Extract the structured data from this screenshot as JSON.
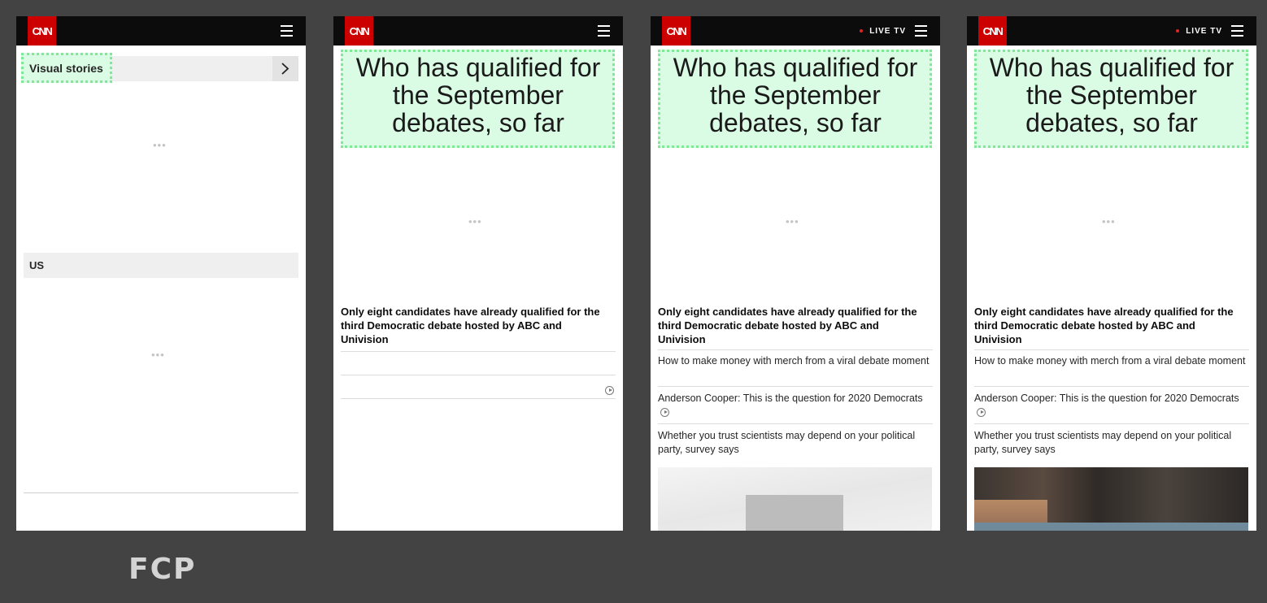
{
  "logo_text": "CNN",
  "live_tv": "LIVE TV",
  "frame1": {
    "section_visual_stories": "Visual stories",
    "section_us": "US",
    "loading_dots": "•••"
  },
  "article": {
    "headline": "Who has qualified for the September debates, so far",
    "lede": "Only eight candidates have already qualified for the third Democratic debate hosted by ABC and Univision",
    "loading_dots": "•••",
    "links": [
      "How to make money with merch from a viral debate moment",
      "Anderson Cooper: This is the question for 2020 Democrats",
      "Whether you trust scientists may depend on your political party, survey says"
    ]
  },
  "caption": "FCP",
  "colors": {
    "brand_red": "#cc0000",
    "highlight_fill": "#dafbe4",
    "highlight_border": "#7eea97",
    "background": "#434343"
  },
  "icons": [
    "menu-icon",
    "chevron-right-icon",
    "play-icon",
    "live-dot-icon"
  ]
}
